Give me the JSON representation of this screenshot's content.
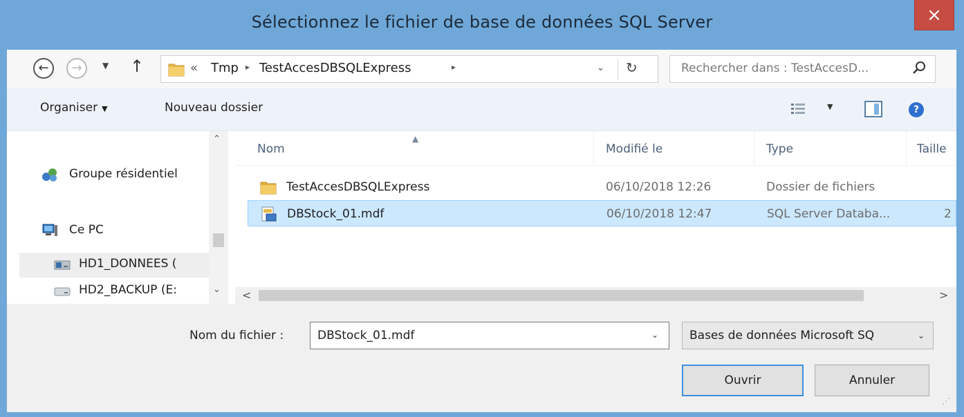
{
  "window": {
    "title": "Sélectionnez le fichier de base de données SQL Server",
    "close_glyph": "×"
  },
  "nav": {
    "back_glyph": "←",
    "forward_glyph": "→",
    "recent_glyph": "▼",
    "up_glyph": "↑"
  },
  "address": {
    "chevrons": "«",
    "crumbs": [
      "Tmp",
      "TestAccesDBSQLExpress"
    ],
    "separator": "▸",
    "dropdown_glyph": "⌄",
    "refresh_glyph": "↻"
  },
  "search": {
    "placeholder": "Rechercher dans : TestAccesD...",
    "icon": "search-icon"
  },
  "toolbar": {
    "organize_label": "Organiser",
    "organize_caret": "▼",
    "new_folder_label": "Nouveau dossier",
    "view_caret": "▼",
    "help_glyph": "?"
  },
  "nav_pane": {
    "items": [
      {
        "label": "Groupe résidentiel",
        "icon": "homegroup-icon"
      },
      {
        "label": "Ce PC",
        "icon": "computer-icon"
      },
      {
        "label": "HD1_DONNEES (",
        "icon": "drive-icon"
      },
      {
        "label": "HD2_BACKUP (E:",
        "icon": "drive-icon"
      }
    ],
    "scroll_up_glyph": "⌃",
    "scroll_down_glyph": "⌄"
  },
  "file_list": {
    "columns": [
      "Nom",
      "Modifié le",
      "Type",
      "Taille"
    ],
    "sort_glyph": "▲",
    "rows": [
      {
        "name": "TestAccesDBSQLExpress",
        "modified": "06/10/2018 12:26",
        "type": "Dossier de fichiers",
        "size": "",
        "icon": "folder-icon"
      },
      {
        "name": "DBStock_01.mdf",
        "modified": "06/10/2018 12:47",
        "type": "SQL Server Databa...",
        "size": "2",
        "icon": "database-file-icon"
      }
    ],
    "scroll_left_glyph": "<",
    "scroll_right_glyph": ">"
  },
  "bottom": {
    "filename_label": "Nom du fichier :",
    "filename_value": "DBStock_01.mdf",
    "dropdown_glyph": "⌄",
    "filetype_value": "Bases de données Microsoft SQ",
    "open_label": "Ouvrir",
    "cancel_label": "Annuler",
    "grip_glyph": "⋰"
  },
  "colors": {
    "title_bar": "#6fa8d8",
    "close_button": "#c74c43",
    "selection": "#cce8ff",
    "focus_border": "#3c8fe0"
  }
}
